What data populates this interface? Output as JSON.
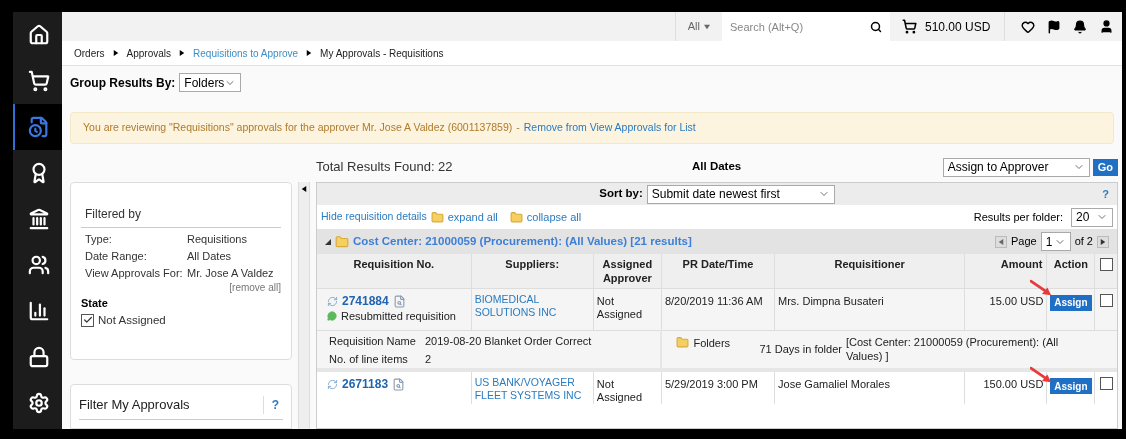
{
  "sidebar": {
    "items": [
      {
        "selected": false
      },
      {
        "selected": false
      },
      {
        "selected": true
      },
      {
        "selected": false
      },
      {
        "selected": false
      },
      {
        "selected": false
      },
      {
        "selected": false
      },
      {
        "selected": false
      },
      {
        "selected": false
      }
    ]
  },
  "top_bar": {
    "scope": "All",
    "search": {
      "placeholder": "Search (Alt+Q)"
    },
    "cart_total": "510.00 USD"
  },
  "breadcrumb": [
    {
      "label": "Orders",
      "link": false
    },
    {
      "label": "Approvals",
      "link": false
    },
    {
      "label": "Requisitions to Approve",
      "link": true
    },
    {
      "label": "My Approvals - Requisitions",
      "link": false
    }
  ],
  "group_by": {
    "label": "Group Results By:",
    "value": "Folders"
  },
  "alert": {
    "text": "You are reviewing \"Requisitions\" approvals for the approver Mr. Jose A Valdez (6001137859)",
    "separator": "-",
    "link": "Remove from View Approvals for List"
  },
  "filter_panel": {
    "title": "Filtered by",
    "rows": [
      {
        "label": "Type:",
        "value": "Requisitions"
      },
      {
        "label": "Date Range:",
        "value": "All Dates"
      },
      {
        "label": "View Approvals For:",
        "value": "Mr. Jose A Valdez"
      }
    ],
    "remove_all": "[remove all]",
    "state_title": "State",
    "state_option": {
      "label": "Not Assigned",
      "checked": true
    }
  },
  "filter_my_approvals": {
    "title": "Filter My Approvals",
    "help": "?"
  },
  "results": {
    "total": "Total Results Found: 22",
    "date_range": "All Dates",
    "action_select": "Assign to Approver",
    "go": "Go"
  },
  "toolbar": {
    "sort_label": "Sort by:",
    "sort_value": "Submit date newest first",
    "help": "?",
    "hide_details": "Hide requisition details",
    "expand_all": "expand all",
    "collapse_all": "collapse all",
    "per_folder_label": "Results per folder:",
    "per_folder_value": "20"
  },
  "folder": {
    "title": "Cost Center: 21000059 (Procurement): (All Values) [21 results]",
    "page_label": "Page",
    "page_value": "1",
    "page_of": "of 2"
  },
  "table": {
    "columns": [
      "Requisition No.",
      "Suppliers:",
      "Assigned Approver",
      "PR Date/Time",
      "Requisitioner",
      "Amount",
      "Action"
    ],
    "select_all": false,
    "rows": [
      {
        "number": "2741884",
        "note": "Resubmitted requisition",
        "supplier": "BIOMEDICAL SOLUTIONS INC",
        "approver": "Not Assigned",
        "date": "8/20/2019 11:36 AM",
        "requisitioner": "Mrs. Dimpna Busateri",
        "amount": "15.00 USD",
        "action": "Assign",
        "checked": false,
        "details": {
          "name_label": "Requisition Name",
          "name": "2019-08-20 Blanket Order Correct",
          "items_label": "No. of line items",
          "items": "2",
          "folders_label": "Folders",
          "days": "71 Days in folder",
          "folder_path": "[Cost Center: 21000059 (Procurement): (All Values) ]"
        }
      },
      {
        "number": "2671183",
        "supplier": "US BANK/VOYAGER FLEET SYSTEMS INC",
        "approver": "Not Assigned",
        "date": "5/29/2019 3:00 PM",
        "requisitioner": "Jose Gamaliel Morales",
        "amount": "150.00 USD",
        "action": "Assign",
        "checked": false
      }
    ]
  }
}
